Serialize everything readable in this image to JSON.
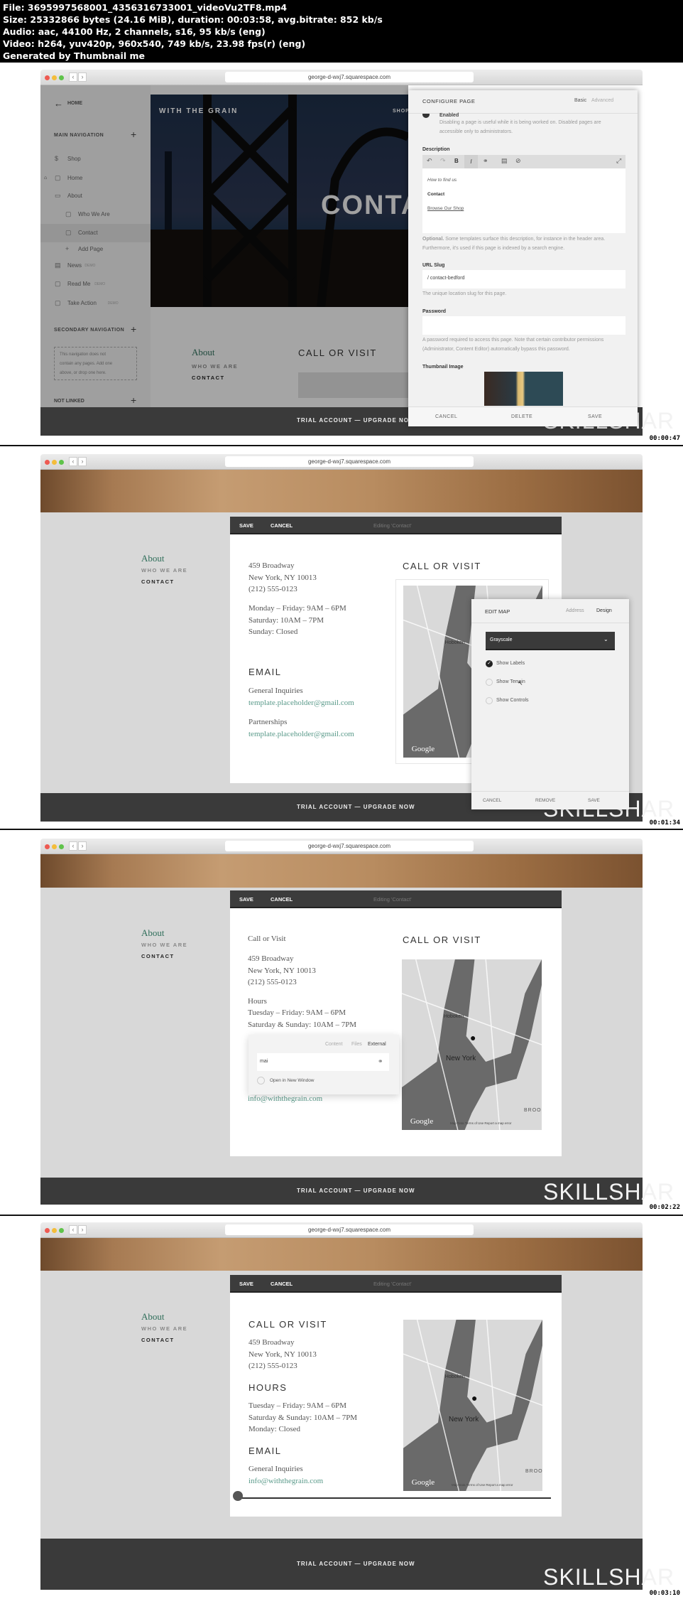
{
  "header": {
    "lines": [
      "File: 3695997568001_4356316733001_videoVu2TF8.mp4",
      "Size: 25332866 bytes (24.16 MiB), duration: 00:03:58, avg.bitrate: 852 kb/s",
      "Audio: aac, 44100 Hz, 2 channels, s16, 95 kb/s (eng)",
      "Video: h264, yuv420p, 960x540, 749 kb/s, 23.98 fps(r) (eng)",
      "Generated by Thumbnail me"
    ]
  },
  "browser": {
    "url": "george-d-wxj7.squarespace.com"
  },
  "footer": {
    "trial": "TRIAL ACCOUNT — UPGRADE NOW",
    "watermark": "SKILLSHARE"
  },
  "timestamps": [
    "00:00:47",
    "00:01:34",
    "00:02:22",
    "00:03:10"
  ],
  "frame1": {
    "sidebar": {
      "home": "HOME",
      "main_nav": "MAIN NAVIGATION",
      "items": [
        {
          "label": "Shop"
        },
        {
          "label": "Home"
        },
        {
          "label": "About"
        },
        {
          "label": "Who We Are"
        },
        {
          "label": "Contact"
        },
        {
          "label": "Add Page"
        },
        {
          "label": "News",
          "badge": "DEMO"
        },
        {
          "label": "Read Me",
          "badge": "DEMO"
        },
        {
          "label": "Take Action",
          "badge": "DEMO"
        }
      ],
      "secondary_nav": "SECONDARY NAVIGATION",
      "secondary_empty": [
        "This navigation does not",
        "contain any pages. Add one",
        "above, or drop one here."
      ],
      "not_linked": "NOT LINKED"
    },
    "site": {
      "brand": "WITH THE GRAIN",
      "shop": "SHOP",
      "hero_title": "CONTA",
      "nav_about": "About",
      "nav_who": "WHO WE ARE",
      "nav_contact": "CONTACT",
      "call": "CALL OR VISIT"
    },
    "panel": {
      "title": "CONFIGURE PAGE",
      "tab_basic": "Basic",
      "tab_advanced": "Advanced",
      "enabled": "Enabled",
      "enabled_help": [
        "Disabling a page is useful while it is being worked on. Disabled pages are",
        "accessible only to administrators."
      ],
      "description_label": "Description",
      "desc_lines": [
        "How to find us",
        "Contact",
        "Browse Our Shop"
      ],
      "desc_help_bold": "Optional.",
      "desc_help": [
        " Some templates surface this description, for instance in the header area.",
        "Furthermore, it's used if this page is indexed by a search engine."
      ],
      "slug_label": "URL Slug",
      "slug_value": "/ contact-bedford",
      "slug_help": "The unique location slug for this page.",
      "password_label": "Password",
      "password_help": [
        "A password required to access this page. Note that certain contributor permissions",
        "(Administrator, Content Editor) automatically bypass this password."
      ],
      "thumb_label": "Thumbnail Image",
      "cancel": "CANCEL",
      "delete": "DELETE",
      "save": "SAVE"
    }
  },
  "editor": {
    "save": "SAVE",
    "cancel": "CANCEL",
    "editing": "Editing 'Contact'",
    "nav_about": "About",
    "nav_who": "WHO WE ARE",
    "nav_contact": "CONTACT"
  },
  "map": {
    "hoboken": "Hoboken",
    "newyork": "New York",
    "google": "Google",
    "brooklyn": "BROO",
    "terms": "Map Data   Terms of Use   Report a map error"
  },
  "frame2": {
    "address": [
      "459 Broadway",
      "New York, NY 10013",
      "(212) 555-0123"
    ],
    "hours": [
      "Monday – Friday: 9AM – 6PM",
      "Saturday: 10AM – 7PM",
      "Sunday: Closed"
    ],
    "email_h": "EMAIL",
    "general": "General Inquiries",
    "email1": "template.placeholder@gmail.com",
    "partner": "Partnerships",
    "email2": "template.placeholder@gmail.com",
    "call": "CALL OR VISIT",
    "editmap": {
      "title": "EDIT MAP",
      "tab_address": "Address",
      "tab_design": "Design",
      "style": "Grayscale",
      "options": [
        {
          "label": "Show Labels",
          "checked": true
        },
        {
          "label": "Show Terrain",
          "checked": false
        },
        {
          "label": "Show Controls",
          "checked": false
        }
      ],
      "cancel": "CANCEL",
      "remove": "REMOVE",
      "save": "SAVE"
    }
  },
  "frame3": {
    "intro": "Call or Visit",
    "address": [
      "459 Broadway",
      "New York, NY 10013",
      "(212) 555-0123"
    ],
    "hours_label": "Hours",
    "hours": [
      "Tuesday – Friday: 9AM – 6PM",
      "Saturday & Sunday: 10AM – 7PM"
    ],
    "email": "info@withthegrain.com",
    "call": "CALL OR VISIT",
    "link_popup": {
      "tab_content": "Content",
      "tab_files": "Files",
      "tab_external": "External",
      "value": "mai",
      "new_window": "Open in New Window"
    }
  },
  "frame4": {
    "call": "CALL OR VISIT",
    "address": [
      "459 Broadway",
      "New York, NY 10013",
      "(212) 555-0123"
    ],
    "hours_h": "HOURS",
    "hours": [
      "Tuesday – Friday: 9AM – 6PM",
      "Saturday & Sunday: 10AM – 7PM",
      "Monday: Closed"
    ],
    "email_h": "EMAIL",
    "general": "General Inquiries",
    "email": "info@withthegrain.com"
  }
}
